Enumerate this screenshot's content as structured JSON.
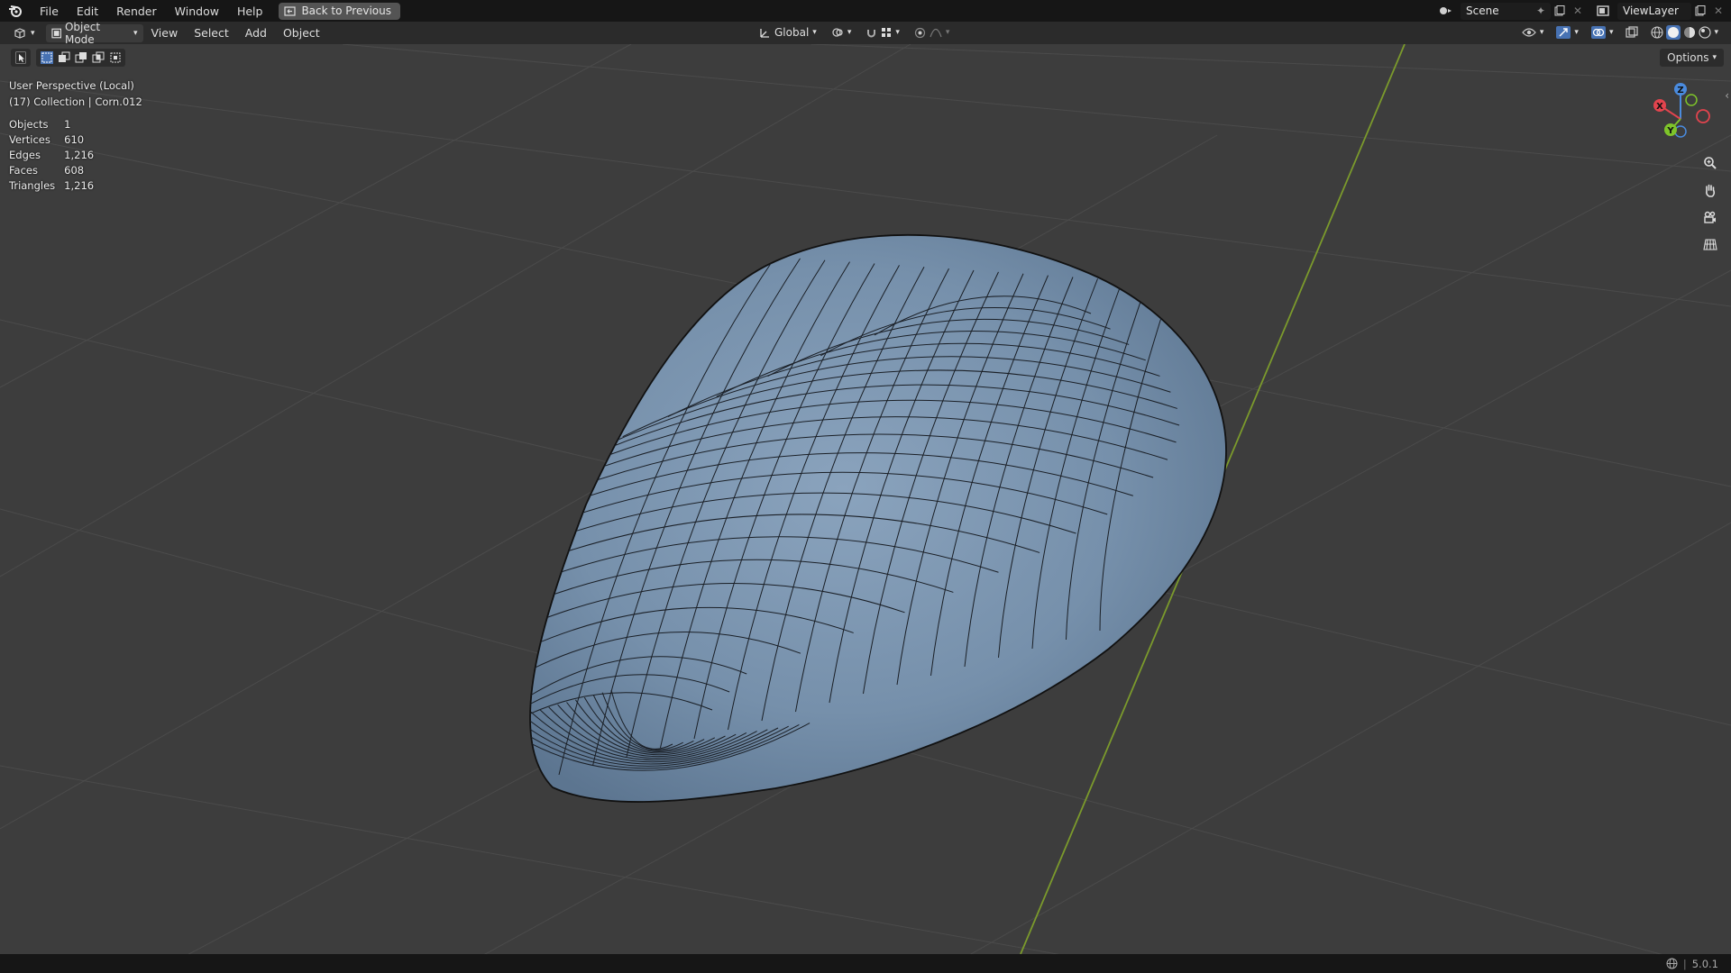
{
  "menubar": {
    "items": [
      "File",
      "Edit",
      "Render",
      "Window",
      "Help"
    ],
    "back_button": "Back to Previous",
    "scene": "Scene",
    "view_layer": "ViewLayer"
  },
  "header": {
    "mode": "Object Mode",
    "menus": [
      "View",
      "Select",
      "Add",
      "Object"
    ],
    "orientation": "Global",
    "options": "Options"
  },
  "viewport": {
    "perspective": "User Perspective (Local)",
    "collection": "(17) Collection | Corn.012",
    "stats": [
      {
        "label": "Objects",
        "value": "1"
      },
      {
        "label": "Vertices",
        "value": "610"
      },
      {
        "label": "Edges",
        "value": "1,216"
      },
      {
        "label": "Faces",
        "value": "608"
      },
      {
        "label": "Triangles",
        "value": "1,216"
      }
    ],
    "gizmo": {
      "z": "Z",
      "x": "X",
      "y": "Y"
    }
  },
  "statusbar": {
    "version": "5.0.1"
  },
  "colors": {
    "mesh": "#7a93ad",
    "grid": "#4a4a4a",
    "y_axis": "#7b9a2c",
    "x_axis": "#e2444e",
    "z_axis": "#4a8bde",
    "gizmo_y": "#7ec42a"
  }
}
